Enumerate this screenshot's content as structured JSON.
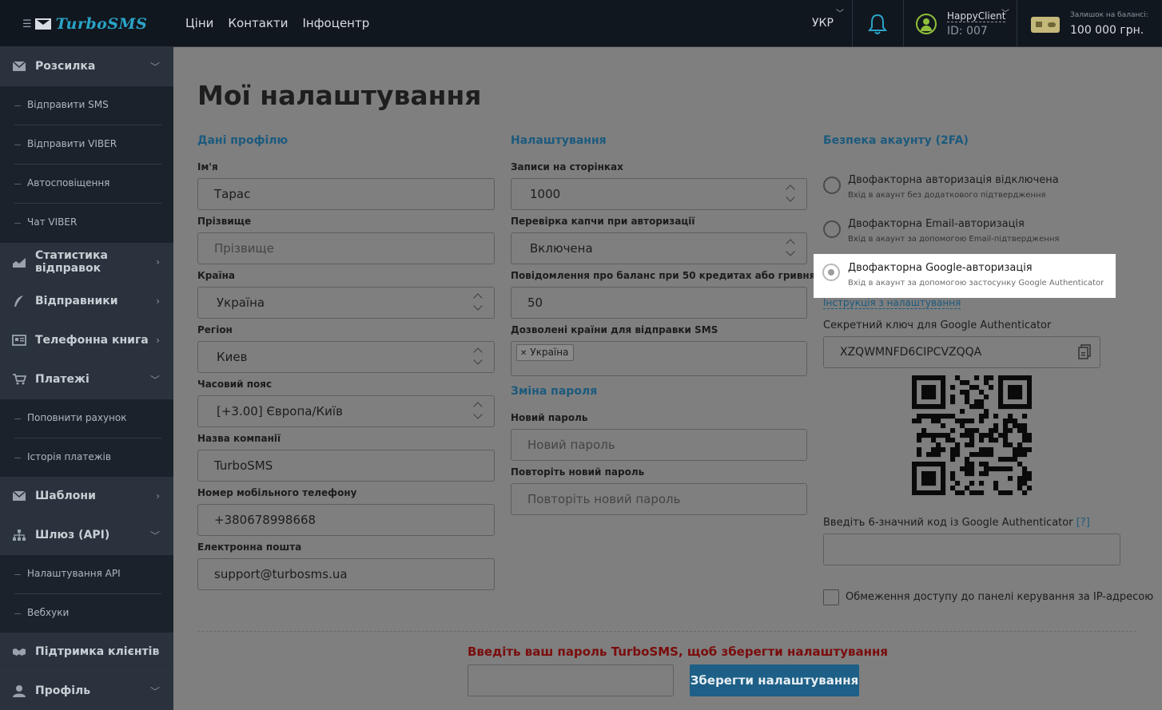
{
  "header": {
    "brand": "TurboSMS",
    "nav": [
      "Ціни",
      "Контакти",
      "Інфоцентр"
    ],
    "language": "УКР",
    "user_name": "HappyClient",
    "user_id": "ID: 007",
    "balance_label": "Залишок на балансі:",
    "balance_value": "100 000 грн."
  },
  "sidebar": {
    "items": [
      {
        "label": "Розсилка",
        "icon": "envelope-icon"
      },
      {
        "label": "Відправити SMS"
      },
      {
        "label": "Відправити VIBER"
      },
      {
        "label": "Автосповіщення"
      },
      {
        "label": "Чат VIBER"
      },
      {
        "label": "Статистика відправок",
        "icon": "chart-icon"
      },
      {
        "label": "Відправники",
        "icon": "feather-icon"
      },
      {
        "label": "Телефонна книга",
        "icon": "contacts-icon"
      },
      {
        "label": "Платежі",
        "icon": "cart-icon"
      },
      {
        "label": "Поповнити рахунок"
      },
      {
        "label": "Історія платежів"
      },
      {
        "label": "Шаблони",
        "icon": "envelope-icon"
      },
      {
        "label": "Шлюз (API)",
        "icon": "sitemap-icon"
      },
      {
        "label": "Налаштування API"
      },
      {
        "label": "Вебхуки"
      },
      {
        "label": "Підтримка клієнтів",
        "icon": "handshake-icon"
      },
      {
        "label": "Профіль",
        "icon": "user-icon"
      }
    ]
  },
  "page": {
    "title": "Мої налаштування"
  },
  "profile": {
    "section_title": "Дані профілю",
    "name_label": "Ім'я",
    "name_value": "Тарас",
    "surname_label": "Прізвище",
    "surname_placeholder": "Прізвище",
    "country_label": "Країна",
    "country_value": "Україна",
    "region_label": "Регіон",
    "region_value": "Киев",
    "timezone_label": "Часовий пояс",
    "timezone_value": "[+3.00] Європа/Київ",
    "company_label": "Назва компанії",
    "company_value": "TurboSMS",
    "phone_label": "Номер мобільного телефону",
    "phone_value": "+380678998668",
    "email_label": "Електронна пошта",
    "email_value": "support@turbosms.ua"
  },
  "settings": {
    "section_title": "Налаштування",
    "records_label": "Записи на сторінках",
    "records_value": "1000",
    "captcha_label": "Перевірка капчи при авторизації",
    "captcha_value": "Включена",
    "balance_notice_label": "Повідомлення про баланс при 50 кредитах або гривнях",
    "balance_notice_value": "50",
    "countries_label": "Дозволені країни для відправки SMS",
    "countries_chip": "Україна",
    "password_section_title": "Зміна пароля",
    "new_password_label": "Новий пароль",
    "new_password_placeholder": "Новий пароль",
    "repeat_password_label": "Повторіть новий пароль",
    "repeat_password_placeholder": "Повторіть новий пароль"
  },
  "security": {
    "section_title": "Безпека акаунту (2FA)",
    "options": [
      {
        "title": "Двофакторна авторизація відключена",
        "subtitle": "Вхід в акаунт без додаткового підтвердження"
      },
      {
        "title": "Двофакторна Email-авторизація",
        "subtitle": "Вхід в акаунт за допомогою Email-підтвердження"
      },
      {
        "title": "Двофакторна Google-авторизація",
        "subtitle": "Вхід в акаунт за допомогою застосунку Google Authenticator"
      }
    ],
    "selected_option": 2,
    "instructions_link": "Інструкція з налаштування",
    "secret_label": "Секретний ключ для Google Authenticator",
    "secret_value": "XZQWMNFD6CIPCVZQQA",
    "code_label": "Введіть 6-значний код із Google Authenticator",
    "code_help": "[?]",
    "ip_restriction_label": "Обмеження доступу до панелі керування за IP-адресою"
  },
  "footer": {
    "warning": "Введіть ваш пароль TurboSMS, щоб зберегти налаштування",
    "save_button": "Зберегти налаштування"
  }
}
